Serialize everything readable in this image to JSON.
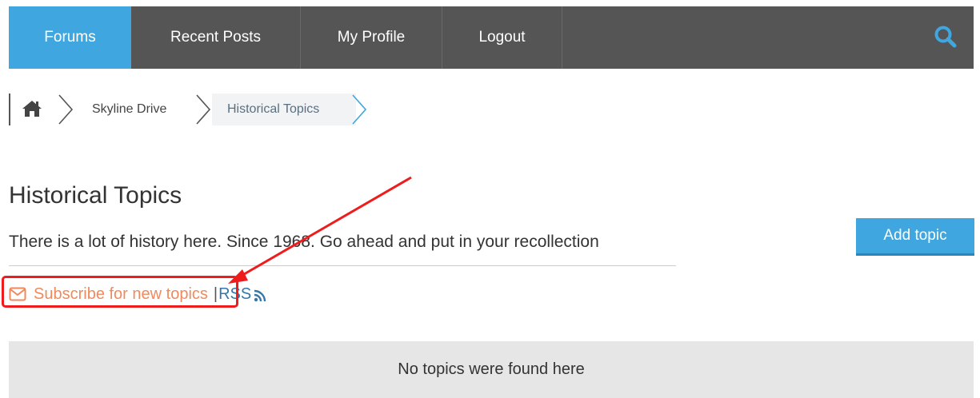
{
  "nav": {
    "items": [
      {
        "label": "Forums",
        "active": true
      },
      {
        "label": "Recent Posts",
        "active": false
      },
      {
        "label": "My Profile",
        "active": false
      },
      {
        "label": "Logout",
        "active": false
      }
    ],
    "search_icon": "search-icon"
  },
  "breadcrumb": {
    "home_icon": "home-icon",
    "items": [
      {
        "label": "Skyline Drive"
      },
      {
        "label": "Historical Topics",
        "current": true
      }
    ]
  },
  "forum": {
    "title": "Historical Topics",
    "description": "There is a lot of history here. Since 1968. Go ahead and put in your recollection",
    "add_topic_label": "Add topic",
    "subscribe_label": "Subscribe for new topics",
    "separator": "|",
    "rss_label": "RSS",
    "empty_message": "No topics were found here"
  },
  "colors": {
    "nav_bg": "#555555",
    "accent": "#3fa6e0",
    "subscribe": "#f08a5d",
    "rss": "#3577a8",
    "annotation": "#ee1c1c",
    "empty_bg": "#e6e6e6"
  }
}
